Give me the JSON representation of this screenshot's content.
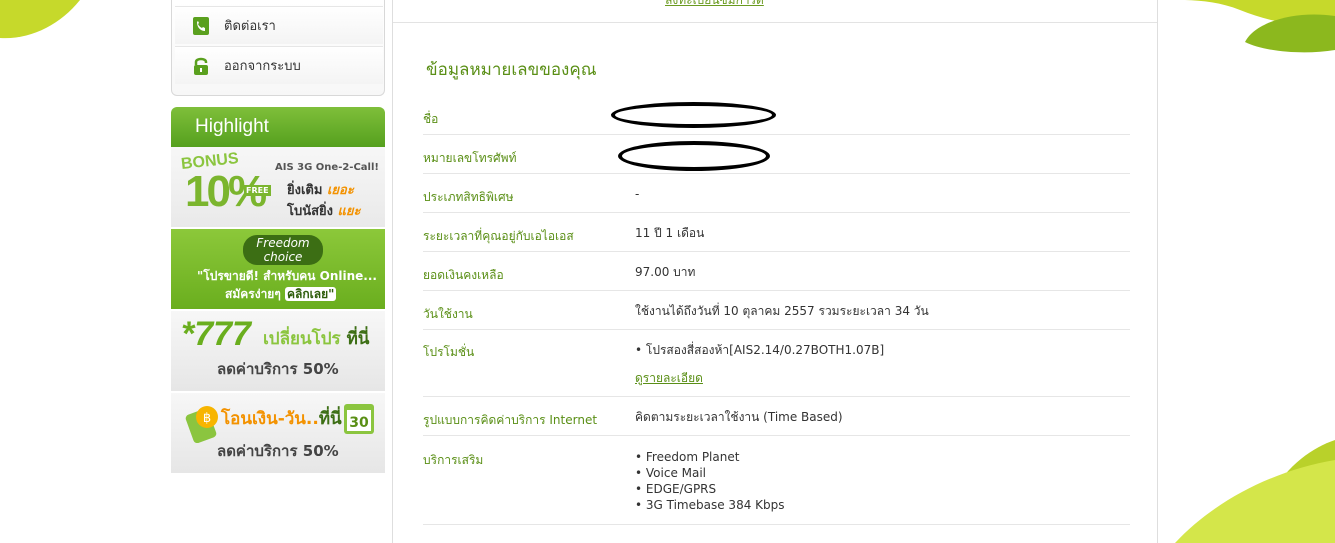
{
  "sidebar": {
    "menu": [
      {
        "label": "ติดต่อเรา",
        "icon": "phone-icon"
      },
      {
        "label": "ออกจากระบบ",
        "icon": "lock-icon"
      }
    ],
    "highlight_title": "Highlight",
    "banners": {
      "bonus": {
        "badge": "BONUS",
        "percent": "10%",
        "free": "FREE",
        "line1": "AIS 3G One-2-Call!",
        "line2a": "ยิ่งเติม ",
        "line2b": "เยอะ",
        "line3a": "โบนัสยิ่ง ",
        "line3b": "แยะ"
      },
      "freedom": {
        "title1": "Freedom",
        "title2": "choice",
        "line1": "\"โปรขายดี! สำหรับคน Online...",
        "line2a": "สมัครง่ายๆ ",
        "line2b": "คลิกเลย\""
      },
      "seven": {
        "code": "*777",
        "line1a": "เปลี่ยนโปร ",
        "line1b": "ที่นี่",
        "line2": "ลดค่าบริการ 50%"
      },
      "transfer": {
        "line1a": "โอนเงิน-วัน..",
        "line1b": "ที่นี่",
        "line2": "ลดค่าบริการ 50%",
        "badge": "30"
      }
    }
  },
  "main": {
    "top_link": "ลงทะเบียนซิมการ์ด",
    "section_title": "ข้อมูลหมายเลขของคุณ",
    "rows": [
      {
        "label": "ชื่อ",
        "value": ""
      },
      {
        "label": "หมายเลขโทรศัพท์",
        "value": ""
      },
      {
        "label": "ประเภทสิทธิพิเศษ",
        "value": "-"
      },
      {
        "label": "ระยะเวลาที่คุณอยู่กับเอไอเอส",
        "value": "11 ปี 1 เดือน"
      },
      {
        "label": "ยอดเงินคงเหลือ",
        "value": "97.00 บาท"
      },
      {
        "label": "วันใช้งาน",
        "value": "ใช้งานได้ถึงวันที่ 10 ตุลาคม 2557 รวมระยะเวลา 34 วัน"
      },
      {
        "label": "โปรโมชั่น",
        "value": "• โปรสองสี่สองห้า[AIS2.14/0.27BOTH1.07B]",
        "link": "ดูรายละเอียด"
      },
      {
        "label": "รูปแบบการคิดค่าบริการ Internet",
        "value": "คิดตามระยะเวลาใช้งาน (Time Based)"
      },
      {
        "label": "บริการเสริม",
        "items": [
          "• Freedom Planet",
          "• Voice Mail",
          "• EDGE/GPRS",
          "• 3G Timebase 384 Kbps"
        ]
      }
    ]
  },
  "colors": {
    "accent_green": "#5a8f16",
    "leaf_green": "#c6d92b",
    "header_green": "#6aae1e"
  }
}
